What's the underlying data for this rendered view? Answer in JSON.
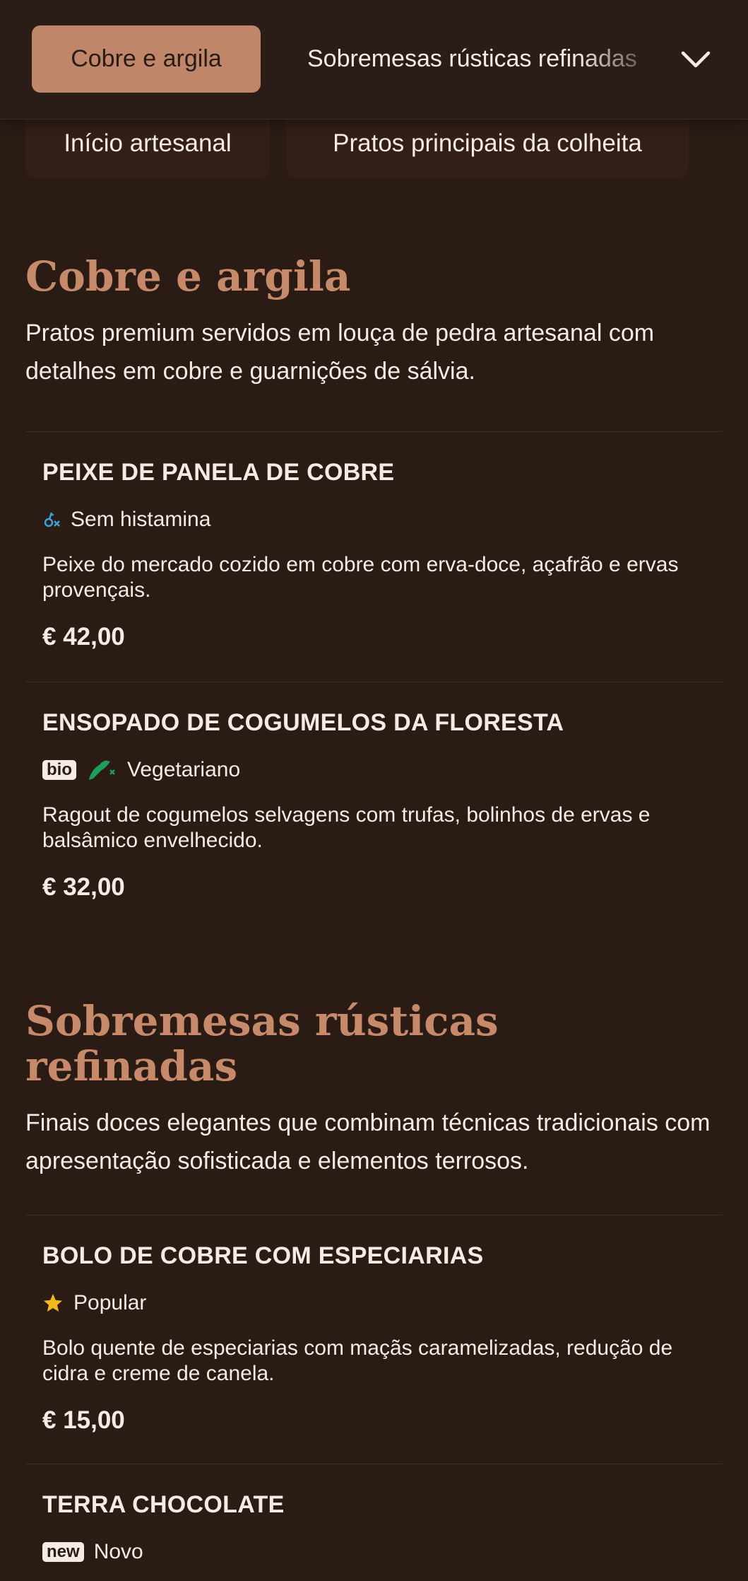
{
  "header": {
    "active_tab": "Cobre e argila",
    "next_tab": "Sobremesas rústicas refinadas",
    "icons": {
      "expand": "chevron-down-icon"
    }
  },
  "categories": [
    {
      "label": "Início artesanal"
    },
    {
      "label": "Pratos principais da colheita"
    }
  ],
  "sections": [
    {
      "title": "Cobre e argila",
      "description": "Pratos premium servidos em louça de pedra artesanal com detalhes em cobre e guarnições de sálvia.",
      "items": [
        {
          "name": "PEIXE DE PANELA DE COBRE",
          "tags": [
            {
              "icon": "histamine-free-icon",
              "label": "Sem histamina"
            }
          ],
          "description": "Peixe do mercado cozido em cobre com erva-doce, açafrão e ervas provençais.",
          "price": "€ 42,00"
        },
        {
          "name": "ENSOPADO DE COGUMELOS DA FLORESTA",
          "tags": [
            {
              "icon": "bio-badge",
              "label": "bio"
            },
            {
              "icon": "vegetarian-icon",
              "label": "Vegetariano"
            }
          ],
          "description": "Ragout de cogumelos selvagens com trufas, bolinhos de ervas e balsâmico envelhecido.",
          "price": "€ 32,00"
        }
      ]
    },
    {
      "title": "Sobremesas rústicas refinadas",
      "description": "Finais doces elegantes que combinam técnicas tradicionais com apresentação sofisticada e elementos terrosos.",
      "items": [
        {
          "name": "BOLO DE COBRE COM ESPECIARIAS",
          "tags": [
            {
              "icon": "star-icon",
              "label": "Popular"
            }
          ],
          "description": "Bolo quente de especiarias com maçãs caramelizadas, redução de cidra e creme de canela.",
          "price": "€ 15,00"
        },
        {
          "name": "TERRA CHOCOLATE",
          "tags": [
            {
              "icon": "new-badge",
              "label": "new"
            },
            {
              "label": "Novo"
            }
          ]
        }
      ]
    }
  ],
  "colors": {
    "background": "#2b1b15",
    "accent": "#c0866a",
    "heading": "#c68a6a",
    "text": "#f3ebe4",
    "vegetarian": "#1e9e5a",
    "histamine": "#3ba3d8",
    "star": "#f3b81c"
  }
}
